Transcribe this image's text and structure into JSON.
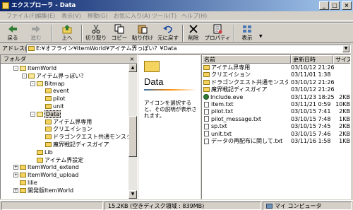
{
  "window": {
    "title": "エクスプローラ - Data"
  },
  "menu": [
    "ファイル(F)",
    "編集(E)",
    "表示(V)",
    "移動(G)",
    "お気に入り(A)",
    "ツール(T)",
    "ヘルプ(H)"
  ],
  "toolbar": {
    "back": "戻る",
    "forward": "進む",
    "up": "上へ",
    "cut": "切り取り",
    "copy": "コピー",
    "paste": "貼り付け",
    "undo": "元に戻す",
    "delete": "削除",
    "properties": "プロパティ",
    "views": "表示"
  },
  "address": {
    "label": "アドレス(D)",
    "path": "E:¥オフライン¥ItemWorld¥アイテム界っぽい？¥Data"
  },
  "folder_pane": {
    "title": "フォルダ",
    "tree": [
      {
        "label": "ItemWorld",
        "state": "open",
        "expander": "-"
      },
      {
        "label": "アイテム界っぽい？",
        "state": "open",
        "expander": "-"
      },
      {
        "label": "Bitmap",
        "state": "open",
        "expander": "-"
      },
      {
        "label": "event",
        "state": "closed",
        "expander": ""
      },
      {
        "label": "pilot",
        "state": "closed",
        "expander": ""
      },
      {
        "label": "unit",
        "state": "closed",
        "expander": ""
      },
      {
        "label": "Data",
        "state": "open",
        "expander": "-",
        "selected": true
      },
      {
        "label": "アイテム界専用",
        "state": "closed",
        "expander": ""
      },
      {
        "label": "クリエイション",
        "state": "closed",
        "expander": ""
      },
      {
        "label": "ドラゴンクエスト共通モンスター",
        "state": "closed",
        "expander": ""
      },
      {
        "label": "魔界戦記ディスガイア",
        "state": "closed",
        "expander": ""
      },
      {
        "label": "Lib",
        "state": "closed",
        "expander": ""
      },
      {
        "label": "アイテム界設定",
        "state": "closed",
        "expander": ""
      },
      {
        "label": "ItemWorld_extend",
        "state": "closed",
        "expander": "+"
      },
      {
        "label": "ItemWorld_upload",
        "state": "closed",
        "expander": "+"
      },
      {
        "label": "lilie",
        "state": "closed",
        "expander": ""
      },
      {
        "label": "開発版ItemWorld",
        "state": "closed",
        "expander": "+"
      }
    ]
  },
  "info_pane": {
    "title": "Data",
    "hint": "アイコンを選択すると、その説明が表示されます。"
  },
  "file_list": {
    "columns": {
      "name": "名前",
      "date": "更新日時",
      "size": "サイズ"
    },
    "rows": [
      {
        "name": "アイテム界専用",
        "date": "03/10/12 21:26",
        "size": "",
        "type": "folder"
      },
      {
        "name": "クリエイション",
        "date": "03/11/01 1:38",
        "size": "",
        "type": "folder"
      },
      {
        "name": "ドラゴンクエスト共通モンスター",
        "date": "03/10/12 21:26",
        "size": "",
        "type": "folder"
      },
      {
        "name": "魔界戦記ディスガイア",
        "date": "03/10/12 21:26",
        "size": "",
        "type": "folder"
      },
      {
        "name": "Include.eve",
        "date": "03/11/23 18:25",
        "size": "2KB",
        "type": "exe"
      },
      {
        "name": "item.txt",
        "date": "03/11/21 0:59",
        "size": "10KB",
        "type": "doc"
      },
      {
        "name": "pilot.txt",
        "date": "03/10/15 7:41",
        "size": "2KB",
        "type": "doc"
      },
      {
        "name": "pilot_message.txt",
        "date": "03/10/15 7:48",
        "size": "1KB",
        "type": "doc"
      },
      {
        "name": "sp.txt",
        "date": "03/10/15 7:45",
        "size": "2KB",
        "type": "doc"
      },
      {
        "name": "unit.txt",
        "date": "03/10/15 7:46",
        "size": "2KB",
        "type": "doc"
      },
      {
        "name": "データの再配布に関して.txt",
        "date": "03/11/16 1:58",
        "size": "1KB",
        "type": "doc"
      }
    ]
  },
  "status": {
    "size_info": "15.2KB (空きディスク領域 : 839MB)",
    "location": "マイ コンピュータ"
  },
  "colors": {
    "title_start": "#0a246a",
    "title_end": "#a6caf0",
    "face": "#d4d0c8",
    "folder": "#f4d35e"
  },
  "icons": [
    "folder-icon",
    "back-icon",
    "forward-icon",
    "up-icon",
    "cut-icon",
    "copy-icon",
    "paste-icon",
    "undo-icon",
    "delete-icon",
    "properties-icon",
    "views-icon",
    "text-file-icon",
    "program-icon",
    "computer-icon"
  ]
}
